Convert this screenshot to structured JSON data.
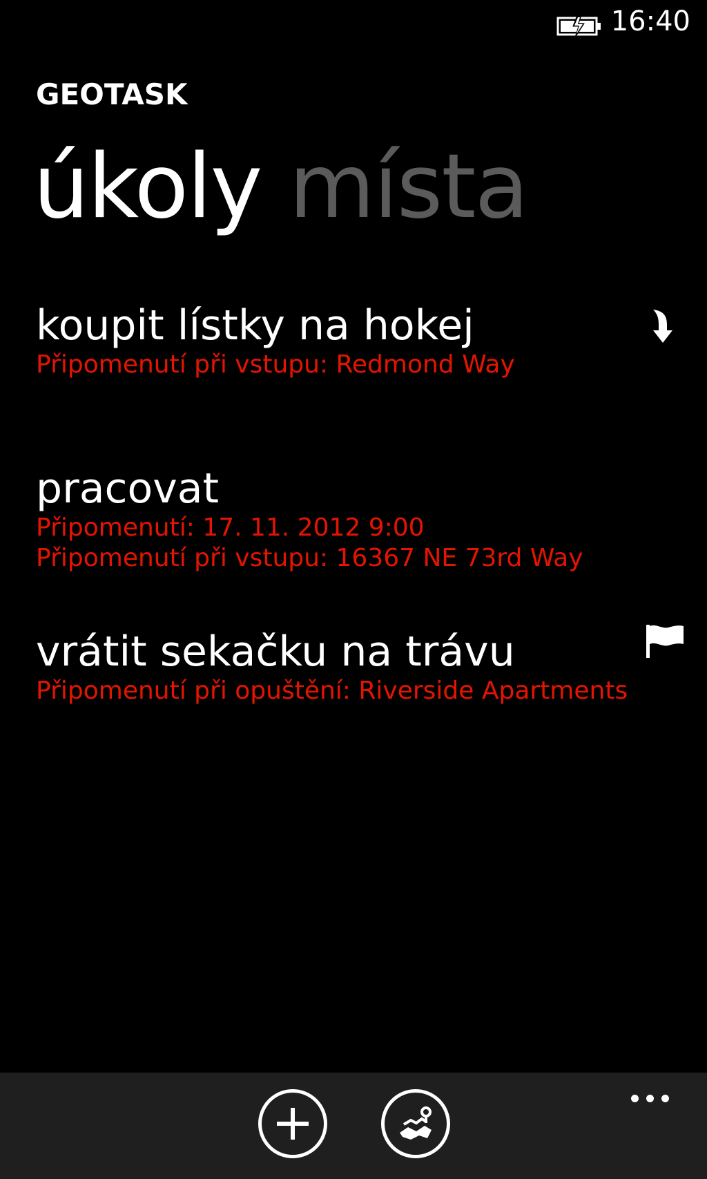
{
  "status_bar": {
    "time": "16:40",
    "battery_icon": "battery-charging-icon"
  },
  "app": {
    "title": "GEOTASK"
  },
  "pivot": {
    "active": "úkoly",
    "inactive": "místa"
  },
  "tasks": [
    {
      "title": "koupit lístky na hokej",
      "reminders": [
        "Připomenutí při vstupu: Redmond Way"
      ],
      "icon": "enter-arrow-icon"
    },
    {
      "title": "pracovat",
      "reminders": [
        "Připomenutí: 17. 11. 2012 9:00",
        "Připomenutí při vstupu: 16367 NE 73rd Way"
      ],
      "icon": ""
    },
    {
      "title": "vrátit sekačku na trávu",
      "reminders": [
        "Připomenutí při opuštění: Riverside Apartments"
      ],
      "icon": "flag-icon"
    }
  ],
  "app_bar": {
    "buttons": [
      "add-icon",
      "map-icon"
    ],
    "more": "more-icon"
  },
  "colors": {
    "background": "#000000",
    "accent": "#e51400",
    "inactive_pivot": "#5b5b5b",
    "app_bar": "#1f1f1f"
  }
}
